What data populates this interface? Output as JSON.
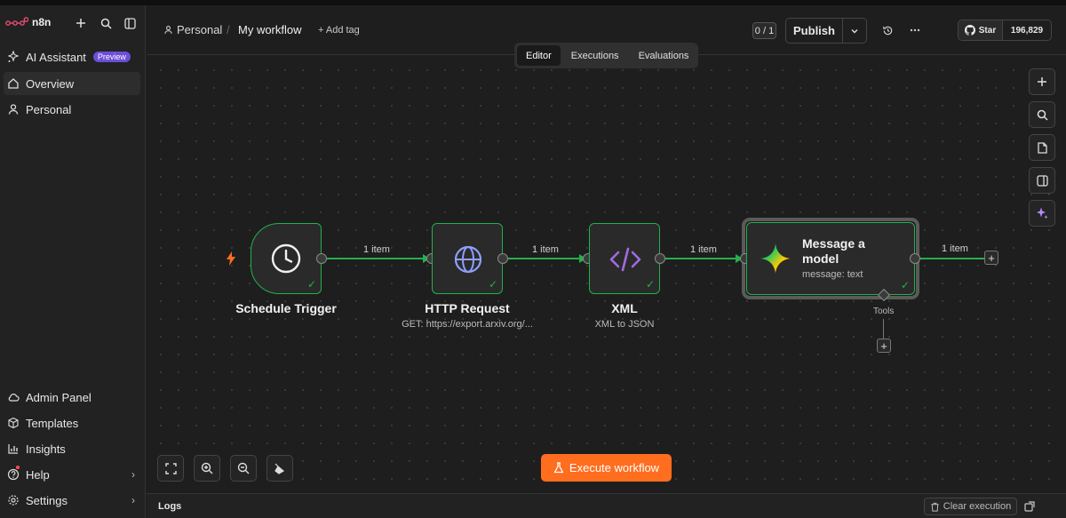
{
  "app": {
    "name": "n8n"
  },
  "sidebar": {
    "items": [
      {
        "label": "AI Assistant",
        "badge": "Preview"
      },
      {
        "label": "Overview"
      },
      {
        "label": "Personal"
      }
    ],
    "bottom_items": [
      {
        "label": "Admin Panel"
      },
      {
        "label": "Templates"
      },
      {
        "label": "Insights"
      },
      {
        "label": "Help"
      },
      {
        "label": "Settings"
      }
    ]
  },
  "header": {
    "project": "Personal",
    "separator": "/",
    "workflow_name": "My workflow",
    "add_tag": "+ Add tag",
    "version_counter": "0 / 1",
    "publish_label": "Publish",
    "github_star": "Star",
    "github_count": "196,829"
  },
  "tabs": [
    {
      "label": "Editor",
      "active": true
    },
    {
      "label": "Executions",
      "active": false
    },
    {
      "label": "Evaluations",
      "active": false
    }
  ],
  "nodes": [
    {
      "title": "Schedule Trigger",
      "subtitle": "",
      "icon": "clock-icon"
    },
    {
      "title": "HTTP Request",
      "subtitle": "GET: https://export.arxiv.org/...",
      "icon": "globe-icon"
    },
    {
      "title": "XML",
      "subtitle": "XML to JSON",
      "icon": "code-icon"
    },
    {
      "title_line1": "Message a",
      "title_line2": "model",
      "subtitle": "message: text",
      "icon": "gemini-sparkle-icon"
    }
  ],
  "edges": [
    {
      "label": "1 item"
    },
    {
      "label": "1 item"
    },
    {
      "label": "1 item"
    },
    {
      "label": "1 item"
    }
  ],
  "tools_label": "Tools",
  "execute_button": "Execute workflow",
  "logs": {
    "title": "Logs",
    "clear_label": "Clear execution"
  },
  "colors": {
    "success": "#22b14c",
    "accent": "#ff6d1f",
    "badge": "#6b4fd8"
  }
}
